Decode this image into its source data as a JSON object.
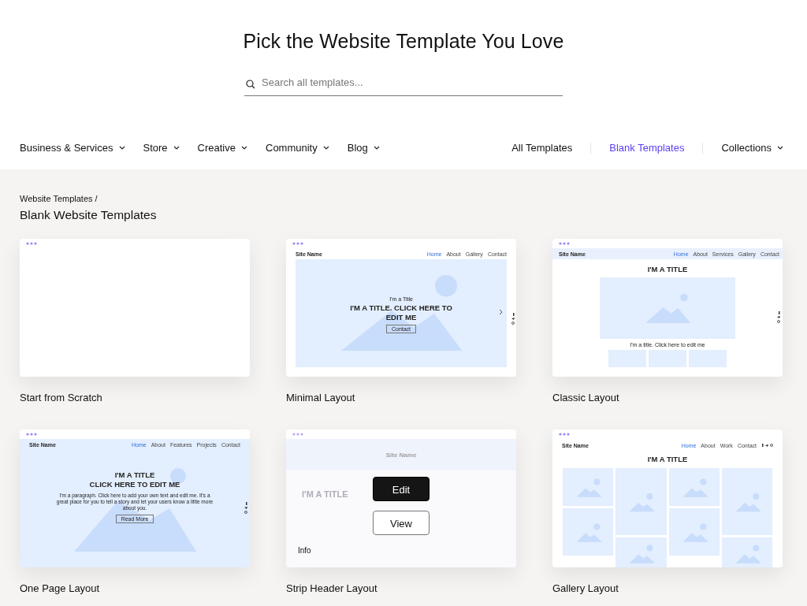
{
  "title": "Pick the Website Template You Love",
  "search": {
    "placeholder": "Search all templates..."
  },
  "categories": [
    {
      "label": "Business & Services",
      "dropdown": true
    },
    {
      "label": "Store",
      "dropdown": true
    },
    {
      "label": "Creative",
      "dropdown": true
    },
    {
      "label": "Community",
      "dropdown": true
    },
    {
      "label": "Blog",
      "dropdown": true
    }
  ],
  "links": [
    {
      "label": "All Templates",
      "selected": false,
      "dropdown": false
    },
    {
      "label": "Blank Templates",
      "selected": true,
      "dropdown": false
    },
    {
      "label": "Collections",
      "selected": false,
      "dropdown": true
    }
  ],
  "breadcrumb": "Website Templates /",
  "heading": "Blank Website Templates",
  "cards": [
    {
      "name": "Start from Scratch",
      "hovered": false,
      "preview": {
        "kind": "blank"
      }
    },
    {
      "name": "Minimal Layout",
      "hovered": false,
      "preview": {
        "kind": "minimal",
        "site_name": "Site Name",
        "nav": [
          {
            "label": "Home",
            "selected": true
          },
          {
            "label": "About",
            "selected": false
          },
          {
            "label": "Gallery",
            "selected": false
          },
          {
            "label": "Contact",
            "selected": false
          }
        ],
        "kicker": "I'm a Title",
        "title": "I'M A TITLE. CLICK HERE TO EDIT ME",
        "button": "Contact"
      }
    },
    {
      "name": "Classic Layout",
      "hovered": false,
      "preview": {
        "kind": "classic",
        "site_name": "Site Name",
        "nav": [
          {
            "label": "Home",
            "selected": true
          },
          {
            "label": "About",
            "selected": false
          },
          {
            "label": "Services",
            "selected": false
          },
          {
            "label": "Gallery",
            "selected": false
          },
          {
            "label": "Contact",
            "selected": false
          }
        ],
        "title": "I'M A TITLE",
        "caption": "I'm a title. Click here to edit me"
      }
    },
    {
      "name": "One Page Layout",
      "hovered": false,
      "preview": {
        "kind": "onepage",
        "site_name": "Site Name",
        "nav": [
          {
            "label": "Home",
            "selected": true
          },
          {
            "label": "About",
            "selected": false
          },
          {
            "label": "Features",
            "selected": false
          },
          {
            "label": "Projects",
            "selected": false
          },
          {
            "label": "Contact",
            "selected": false
          }
        ],
        "title_lines": [
          "I'M A TITLE",
          "CLICK HERE TO EDIT ME"
        ],
        "paragraph": "I'm a paragraph. Click here to add your own text and edit me. It's a great place for you to tell a story and let your users know a little more about you.",
        "button": "Read More"
      }
    },
    {
      "name": "Strip Header Layout",
      "hovered": true,
      "actions": [
        {
          "label": "Edit",
          "kind": "primary"
        },
        {
          "label": "View",
          "kind": "secondary"
        }
      ],
      "info": "Info",
      "preview": {
        "kind": "strip",
        "site_name": "Site Name",
        "title": "I'M A TITLE"
      }
    },
    {
      "name": "Gallery Layout",
      "hovered": false,
      "preview": {
        "kind": "gallery",
        "site_name": "Site Name",
        "nav": [
          {
            "label": "Home",
            "selected": true
          },
          {
            "label": "About",
            "selected": false
          },
          {
            "label": "Work",
            "selected": false
          },
          {
            "label": "Contact",
            "selected": false
          }
        ],
        "title": "I'M A TITLE"
      }
    }
  ]
}
